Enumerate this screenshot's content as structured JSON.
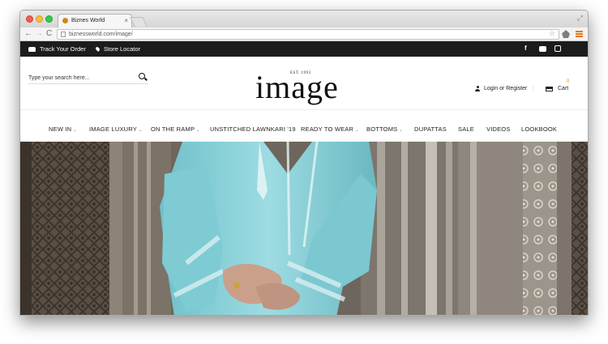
{
  "browser": {
    "tab_title": "Biznes World",
    "tab_close": "×",
    "url": "biznessworld.com/image/",
    "nav": {
      "back": "←",
      "forward": "→",
      "reload": "C"
    },
    "star": "☆",
    "resize": "⤢"
  },
  "topbar": {
    "track_label": "Track Your Order",
    "store_label": "Store Locator",
    "facebook": "f"
  },
  "header": {
    "search_placeholder": "Type your search here...",
    "logo_est": "EST. 1993",
    "logo_text": "image",
    "account_label": "Login or Register",
    "separator": "|",
    "cart_label": "Cart",
    "cart_count": "0"
  },
  "nav": {
    "items": [
      {
        "label": "NEW IN",
        "caret": "⌄"
      },
      {
        "label": "IMAGE LUXURY",
        "caret": "⌄"
      },
      {
        "label": "ON THE RAMP",
        "caret": "⌄"
      },
      {
        "label": "UNSTITCHED LAWNKARI '19",
        "caret": ""
      },
      {
        "label": "READY TO WEAR",
        "caret": "⌄"
      },
      {
        "label": "BOTTOMS",
        "caret": "⌄"
      },
      {
        "label": "DUPATTAS",
        "caret": ""
      },
      {
        "label": "SALE",
        "caret": ""
      },
      {
        "label": "VIDEOS",
        "caret": ""
      },
      {
        "label": "LOOKBOOK",
        "caret": ""
      }
    ]
  },
  "colors": {
    "topbar_bg": "#1c1c1c",
    "accent": "#e8771a",
    "dress": "#8fd3da"
  }
}
